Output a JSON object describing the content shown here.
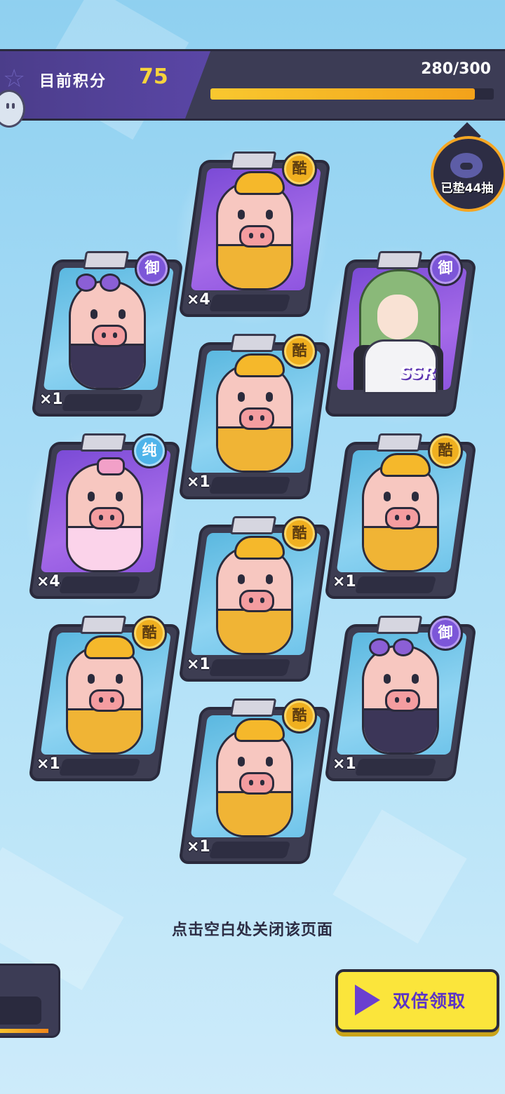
{
  "header": {
    "score_label": "目前积分",
    "score_value": "75",
    "progress_text": "280/300",
    "progress_fraction": 0.933
  },
  "pity_badge": {
    "text": "已垫44抽"
  },
  "cards": [
    {
      "tag": "酷",
      "count": "×4",
      "type": "pig-hat",
      "rarity": "purple"
    },
    {
      "tag": "御",
      "count": "×1",
      "type": "pig-suit",
      "rarity": "blue"
    },
    {
      "tag": "御",
      "count": "",
      "type": "ssr-girl",
      "rarity": "purple",
      "label": "SSR"
    },
    {
      "tag": "酷",
      "count": "×1",
      "type": "pig-hat",
      "rarity": "blue"
    },
    {
      "tag": "纯",
      "count": "×4",
      "type": "pig-pink",
      "rarity": "purple"
    },
    {
      "tag": "酷",
      "count": "×1",
      "type": "pig-hat",
      "rarity": "blue"
    },
    {
      "tag": "酷",
      "count": "×1",
      "type": "pig-hat",
      "rarity": "blue"
    },
    {
      "tag": "酷",
      "count": "×1",
      "type": "pig-hat",
      "rarity": "blue"
    },
    {
      "tag": "御",
      "count": "×1",
      "type": "pig-suit",
      "rarity": "blue"
    },
    {
      "tag": "酷",
      "count": "×1",
      "type": "pig-hat",
      "rarity": "blue"
    }
  ],
  "hint_text": "点击空白处关闭该页面",
  "double_button": {
    "label": "双倍领取",
    "icon": "play-icon"
  },
  "colors": {
    "accent_yellow": "#fbe53b",
    "accent_purple": "#6a3fd0",
    "bar_dark": "#3c3c55"
  }
}
